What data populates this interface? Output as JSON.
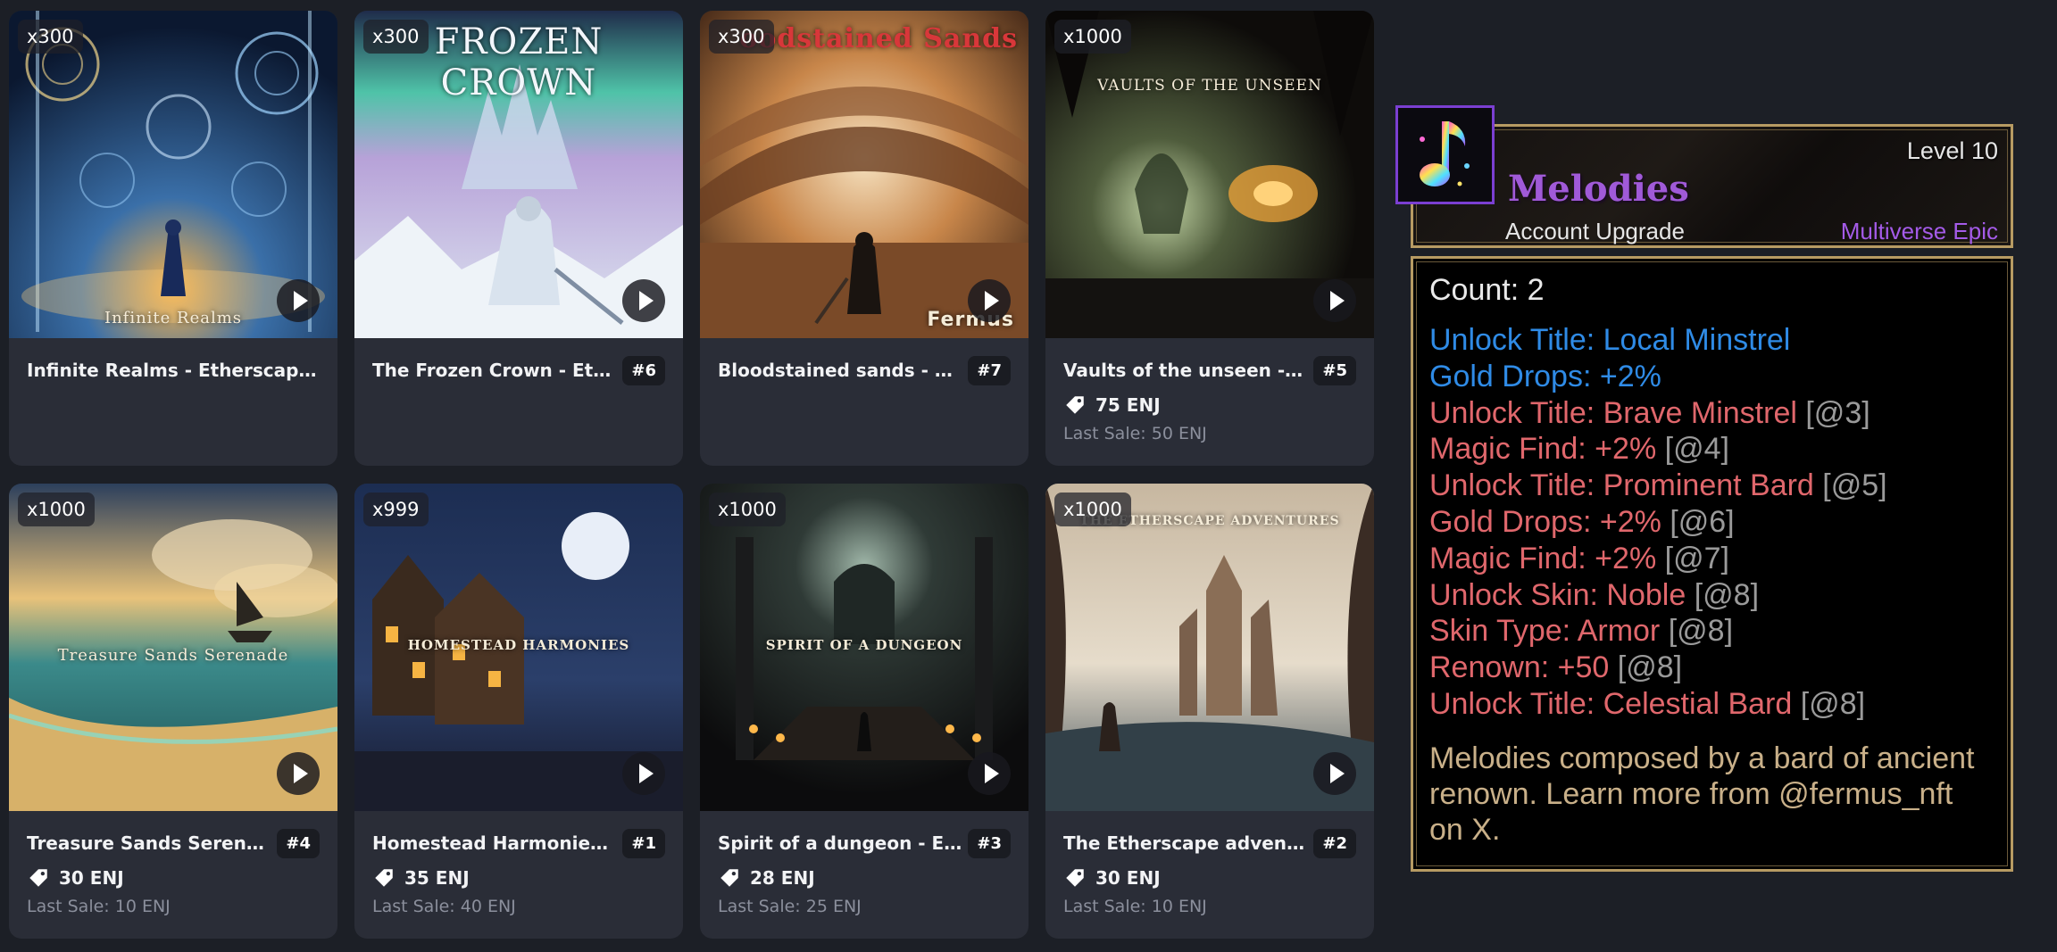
{
  "cards": [
    {
      "qty": "x300",
      "name": "Infinite Realms - Etherscape M...",
      "id": "",
      "price": "",
      "last_sale": "",
      "art_title": "Infinite Realms"
    },
    {
      "qty": "x300",
      "name": "The Frozen Crown - Ethers...",
      "id": "#6",
      "price": "",
      "last_sale": "",
      "art_title": "FROZEN CROWN"
    },
    {
      "qty": "x300",
      "name": "Bloodstained sands - Ethe...",
      "id": "#7",
      "price": "",
      "last_sale": "",
      "art_title": "oodstained Sands",
      "art_sig": "Fermus"
    },
    {
      "qty": "x1000",
      "name": "Vaults of the unseen - Eth...",
      "id": "#5",
      "price": "75 ENJ",
      "last_sale": "Last Sale: 50 ENJ",
      "art_title": "VAULTS OF THE UNSEEN"
    },
    {
      "qty": "x1000",
      "name": "Treasure Sands Serenade ...",
      "id": "#4",
      "price": "30 ENJ",
      "last_sale": "Last Sale: 10 ENJ",
      "art_title": "Treasure Sands Serenade"
    },
    {
      "qty": "x999",
      "name": "Homestead Harmonies - T...",
      "id": "#1",
      "price": "35 ENJ",
      "last_sale": "Last Sale: 40 ENJ",
      "art_title": "HOMESTEAD HARMONIES"
    },
    {
      "qty": "x1000",
      "name": "Spirit of a dungeon - Ether...",
      "id": "#3",
      "price": "28 ENJ",
      "last_sale": "Last Sale: 25 ENJ",
      "art_title": "SPIRIT OF A DUNGEON"
    },
    {
      "qty": "x1000",
      "name": "The Etherscape adventure...",
      "id": "#2",
      "price": "30 ENJ",
      "last_sale": "Last Sale: 10 ENJ",
      "art_title": "THE ETHERSCAPE ADVENTURES"
    }
  ],
  "tooltip": {
    "level": "Level 10",
    "name": "Melodies",
    "type": "Account Upgrade",
    "rarity": "Multiverse Epic",
    "count": "Count: 2",
    "props": [
      {
        "text": "Unlock Title: Local Minstrel",
        "req": "",
        "color": "blue"
      },
      {
        "text": "Gold Drops: +2%",
        "req": "",
        "color": "blue"
      },
      {
        "text": "Unlock Title: Brave Minstrel",
        "req": "[@3]",
        "color": "red"
      },
      {
        "text": "Magic Find: +2%",
        "req": "[@4]",
        "color": "red"
      },
      {
        "text": "Unlock Title: Prominent Bard",
        "req": "[@5]",
        "color": "red"
      },
      {
        "text": "Gold Drops: +2%",
        "req": "[@6]",
        "color": "red"
      },
      {
        "text": "Magic Find: +2%",
        "req": "[@7]",
        "color": "red"
      },
      {
        "text": "Unlock Skin: Noble",
        "req": "[@8]",
        "color": "red"
      },
      {
        "text": "Skin Type: Armor",
        "req": "[@8]",
        "color": "red"
      },
      {
        "text": "Renown: +50",
        "req": "[@8]",
        "color": "red"
      },
      {
        "text": "Unlock Title: Celestial Bard",
        "req": "[@8]",
        "color": "red"
      }
    ],
    "description": "Melodies composed by a bard of ancient renown. Learn more from @fermus_nft on X."
  },
  "colors": {
    "page_bg": "#1c1f26",
    "card_bg": "#2a2d37",
    "prop_blue": "#2f8be6",
    "prop_red": "#e0676c",
    "rarity_purple": "#a45be8",
    "frame_gold": "#b79b63"
  }
}
